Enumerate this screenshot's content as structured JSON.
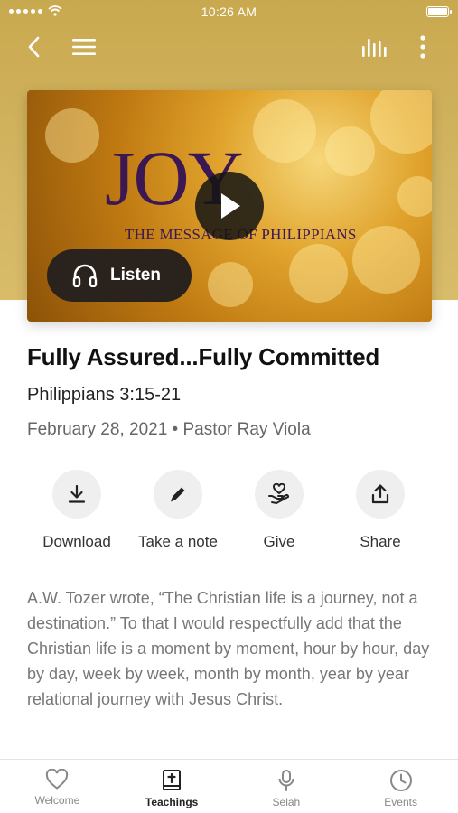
{
  "status_bar": {
    "time": "10:26 AM"
  },
  "nav": {
    "back_icon": "chevron-left-icon",
    "menu_icon": "hamburger-menu-icon",
    "audio_icon": "audio-levels-icon",
    "more_icon": "more-vertical-icon"
  },
  "hero": {
    "title": "JOY",
    "subtitle": "THE MESSAGE OF PHILIPPIANS",
    "listen_label": "Listen",
    "colors": {
      "title": "#3b1853",
      "listen_bg": "#2a221d",
      "header_bg": "#d3b562"
    }
  },
  "sermon": {
    "title": "Fully Assured...Fully Committed",
    "scripture": "Philippians 3:15-21",
    "meta": "February 28, 2021 • Pastor Ray Viola",
    "description": "A.W. Tozer wrote, “The Christian life is a journey, not a destination.” To that I would respectfully add that the Christian life is a moment by moment, hour by hour, day by day, week by week, month by month, year by year relational journey with Jesus Christ."
  },
  "actions": [
    {
      "label": "Download",
      "icon": "download-icon"
    },
    {
      "label": "Take a note",
      "icon": "pencil-icon"
    },
    {
      "label": "Give",
      "icon": "give-hand-heart-icon"
    },
    {
      "label": "Share",
      "icon": "share-icon"
    }
  ],
  "tabs": [
    {
      "label": "Welcome",
      "icon": "heart-icon",
      "active": false
    },
    {
      "label": "Teachings",
      "icon": "bible-icon",
      "active": true
    },
    {
      "label": "Selah",
      "icon": "microphone-icon",
      "active": false
    },
    {
      "label": "Events",
      "icon": "clock-icon",
      "active": false
    }
  ]
}
